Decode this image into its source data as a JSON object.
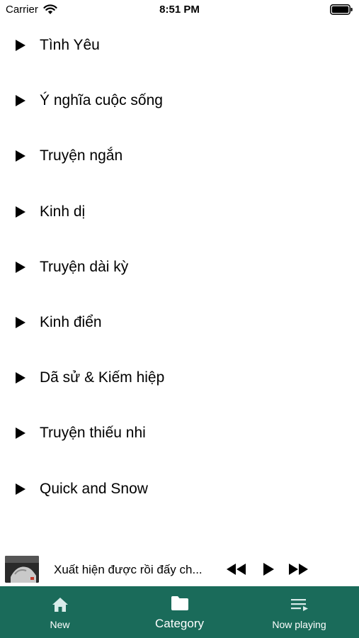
{
  "status_bar": {
    "carrier": "Carrier",
    "time": "8:51 PM"
  },
  "categories": [
    {
      "label": "Tình Yêu"
    },
    {
      "label": "Ý nghĩa cuộc sống"
    },
    {
      "label": "Truyện ngắn"
    },
    {
      "label": "Kinh dị"
    },
    {
      "label": "Truyện dài kỳ"
    },
    {
      "label": "Kinh điển"
    },
    {
      "label": "Dã sử & Kiếm hiệp"
    },
    {
      "label": "Truyện thiếu nhi"
    },
    {
      "label": "Quick and Snow"
    }
  ],
  "mini_player": {
    "title": "Xuất hiện được rồi đấy ch...",
    "controls": [
      "rewind-icon",
      "play-icon",
      "fast-forward-icon"
    ]
  },
  "tab_bar": {
    "tabs": [
      {
        "label": "New",
        "icon": "home-icon"
      },
      {
        "label": "Category",
        "icon": "folder-icon"
      },
      {
        "label": "Now playing",
        "icon": "playlist-icon"
      }
    ]
  },
  "colors": {
    "tab_bar_bg": "#1a6b5a",
    "tab_text": "#ffffff",
    "text": "#000000"
  }
}
